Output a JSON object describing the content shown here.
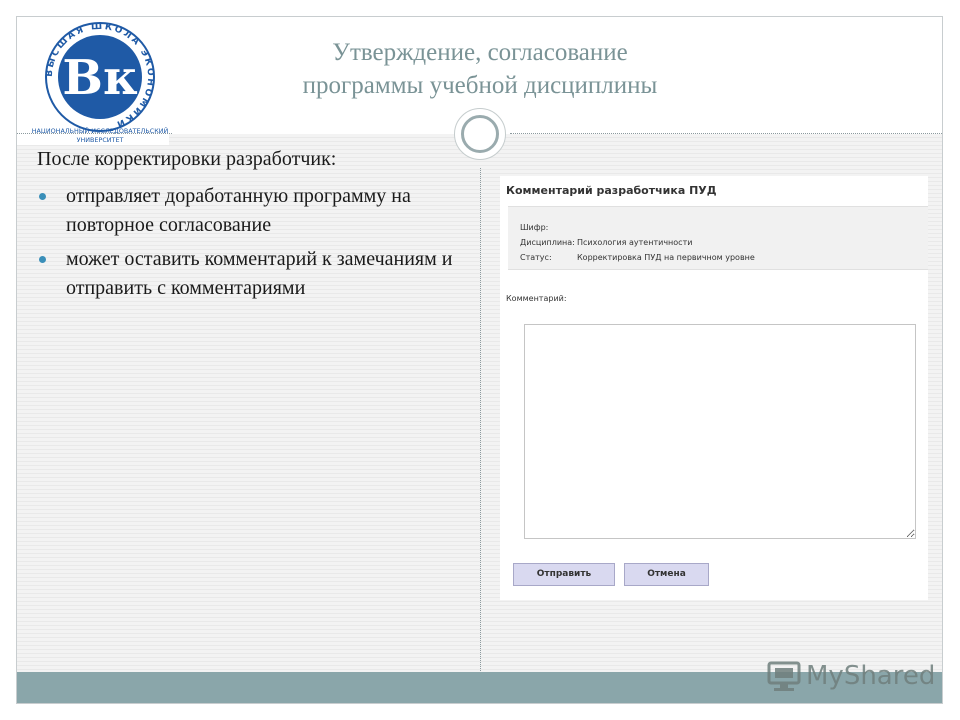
{
  "slide": {
    "title_line1": "Утверждение, согласование",
    "title_line2": "программы учебной дисциплины",
    "subhead": "После корректировки разработчик:",
    "bullets": [
      "отправляет  доработанную программу на повторное согласование",
      "может оставить комментарий к замечаниям и отправить с комментариями"
    ]
  },
  "logo": {
    "monogram": "Вк",
    "ring_text": "ВЫСШАЯ ШКОЛА ЭКОНОМИКИ",
    "caption_line1": "НАЦИОНАЛЬНЫЙ ИССЛЕДОВАТЕЛЬСКИЙ",
    "caption_line2": "УНИВЕРСИТЕТ"
  },
  "form": {
    "title": "Комментарий разработчика ПУД",
    "info": [
      {
        "key": "Шифр:",
        "value": ""
      },
      {
        "key": "Дисциплина:",
        "value": "Психология аутентичности"
      },
      {
        "key": "Статус:",
        "value": "Корректировка ПУД на первичном уровне"
      }
    ],
    "comment_label": "Комментарий:",
    "comment_value": "",
    "send_label": "Отправить",
    "cancel_label": "Отмена"
  },
  "watermark": {
    "text": "MyShared"
  },
  "colors": {
    "title": "#7a9396",
    "bullet": "#3a8fb9",
    "footer": "#8aa6aa",
    "logo_blue": "#1f5aa6",
    "button_bg": "#d9d9f0"
  },
  "icons": [
    "hse-logo-icon",
    "bullet-dot-icon",
    "circle-ornament-icon",
    "myshared-icon"
  ]
}
